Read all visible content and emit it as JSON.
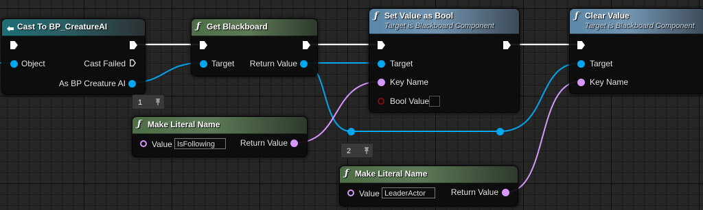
{
  "nodes": {
    "cast": {
      "title": "Cast To BP_CreatureAI",
      "object_label": "Object",
      "cast_failed_label": "Cast Failed",
      "as_label": "As BP Creature AI"
    },
    "get_blackboard": {
      "title": "Get Blackboard",
      "target_label": "Target",
      "return_label": "Return Value"
    },
    "set_value_bool": {
      "title": "Set Value as Bool",
      "subtitle": "Target is Blackboard Component",
      "target_label": "Target",
      "key_name_label": "Key Name",
      "bool_value_label": "Bool Value"
    },
    "clear_value": {
      "title": "Clear Value",
      "subtitle": "Target is Blackboard Component",
      "target_label": "Target",
      "key_name_label": "Key Name"
    },
    "make_literal_1": {
      "title": "Make Literal Name",
      "value_label": "Value",
      "value": "IsFollowing",
      "return_label": "Return Value"
    },
    "make_literal_2": {
      "title": "Make Literal Name",
      "value_label": "Value",
      "value": "LeaderActor",
      "return_label": "Return Value"
    }
  },
  "comment_badges": [
    {
      "text": "1"
    },
    {
      "text": "2"
    }
  ],
  "colors": {
    "object_pin": "#00a7f0",
    "name_pin": "#d896ff",
    "bool_pin": "#7b0f0f",
    "exec_wire": "#ffffff"
  },
  "icons": {
    "function": "function-icon",
    "cast": "cast-icon",
    "exec": "exec-pin-icon",
    "pin": "pin-icon"
  }
}
